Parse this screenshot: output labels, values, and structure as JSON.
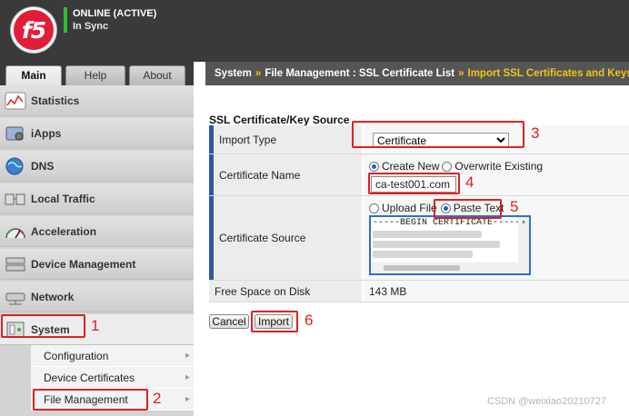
{
  "header": {
    "logo_text": "f5",
    "status": "ONLINE (ACTIVE)",
    "sync": "In Sync",
    "status_color": "#2fbf2f"
  },
  "tabs": [
    {
      "label": "Main",
      "active": true
    },
    {
      "label": "Help",
      "active": false
    },
    {
      "label": "About",
      "active": false
    }
  ],
  "breadcrumb": {
    "part1": "System",
    "sep": "»",
    "part2": "File Management : SSL Certificate List",
    "current": "Import SSL Certificates and Keys"
  },
  "sidebar": {
    "items": [
      {
        "label": "Statistics",
        "icon": "statistics-icon"
      },
      {
        "label": "iApps",
        "icon": "iapps-icon"
      },
      {
        "label": "DNS",
        "icon": "dns-globe-icon"
      },
      {
        "label": "Local Traffic",
        "icon": "local-traffic-icon"
      },
      {
        "label": "Acceleration",
        "icon": "acceleration-gauge-icon"
      },
      {
        "label": "Device Management",
        "icon": "device-management-icon"
      },
      {
        "label": "Network",
        "icon": "network-icon"
      },
      {
        "label": "System",
        "icon": "system-icon"
      }
    ],
    "submenu": [
      {
        "label": "Configuration"
      },
      {
        "label": "Device Certificates"
      },
      {
        "label": "File Management"
      }
    ]
  },
  "form": {
    "section_title": "SSL Certificate/Key Source",
    "import_type": {
      "label": "Import Type",
      "value": "Certificate"
    },
    "cert_name": {
      "label": "Certificate Name",
      "opt_new": "Create New",
      "opt_overwrite": "Overwrite Existing",
      "value": "ca-test001.com"
    },
    "cert_source": {
      "label": "Certificate Source",
      "opt_upload": "Upload File",
      "opt_paste": "Paste Text",
      "text_first_line": "-----BEGIN CERTIFICATE-----"
    },
    "free_space": {
      "label": "Free Space on Disk",
      "value": "143 MB"
    }
  },
  "buttons": {
    "cancel": "Cancel",
    "import": "Import"
  },
  "annotations": [
    "1",
    "2",
    "3",
    "4",
    "5",
    "6"
  ],
  "watermark": "CSDN @weixiao20210727",
  "colors": {
    "accent": "#2c5aa0",
    "annotation": "#e02020",
    "breadcrumb_current": "#f0c419"
  }
}
